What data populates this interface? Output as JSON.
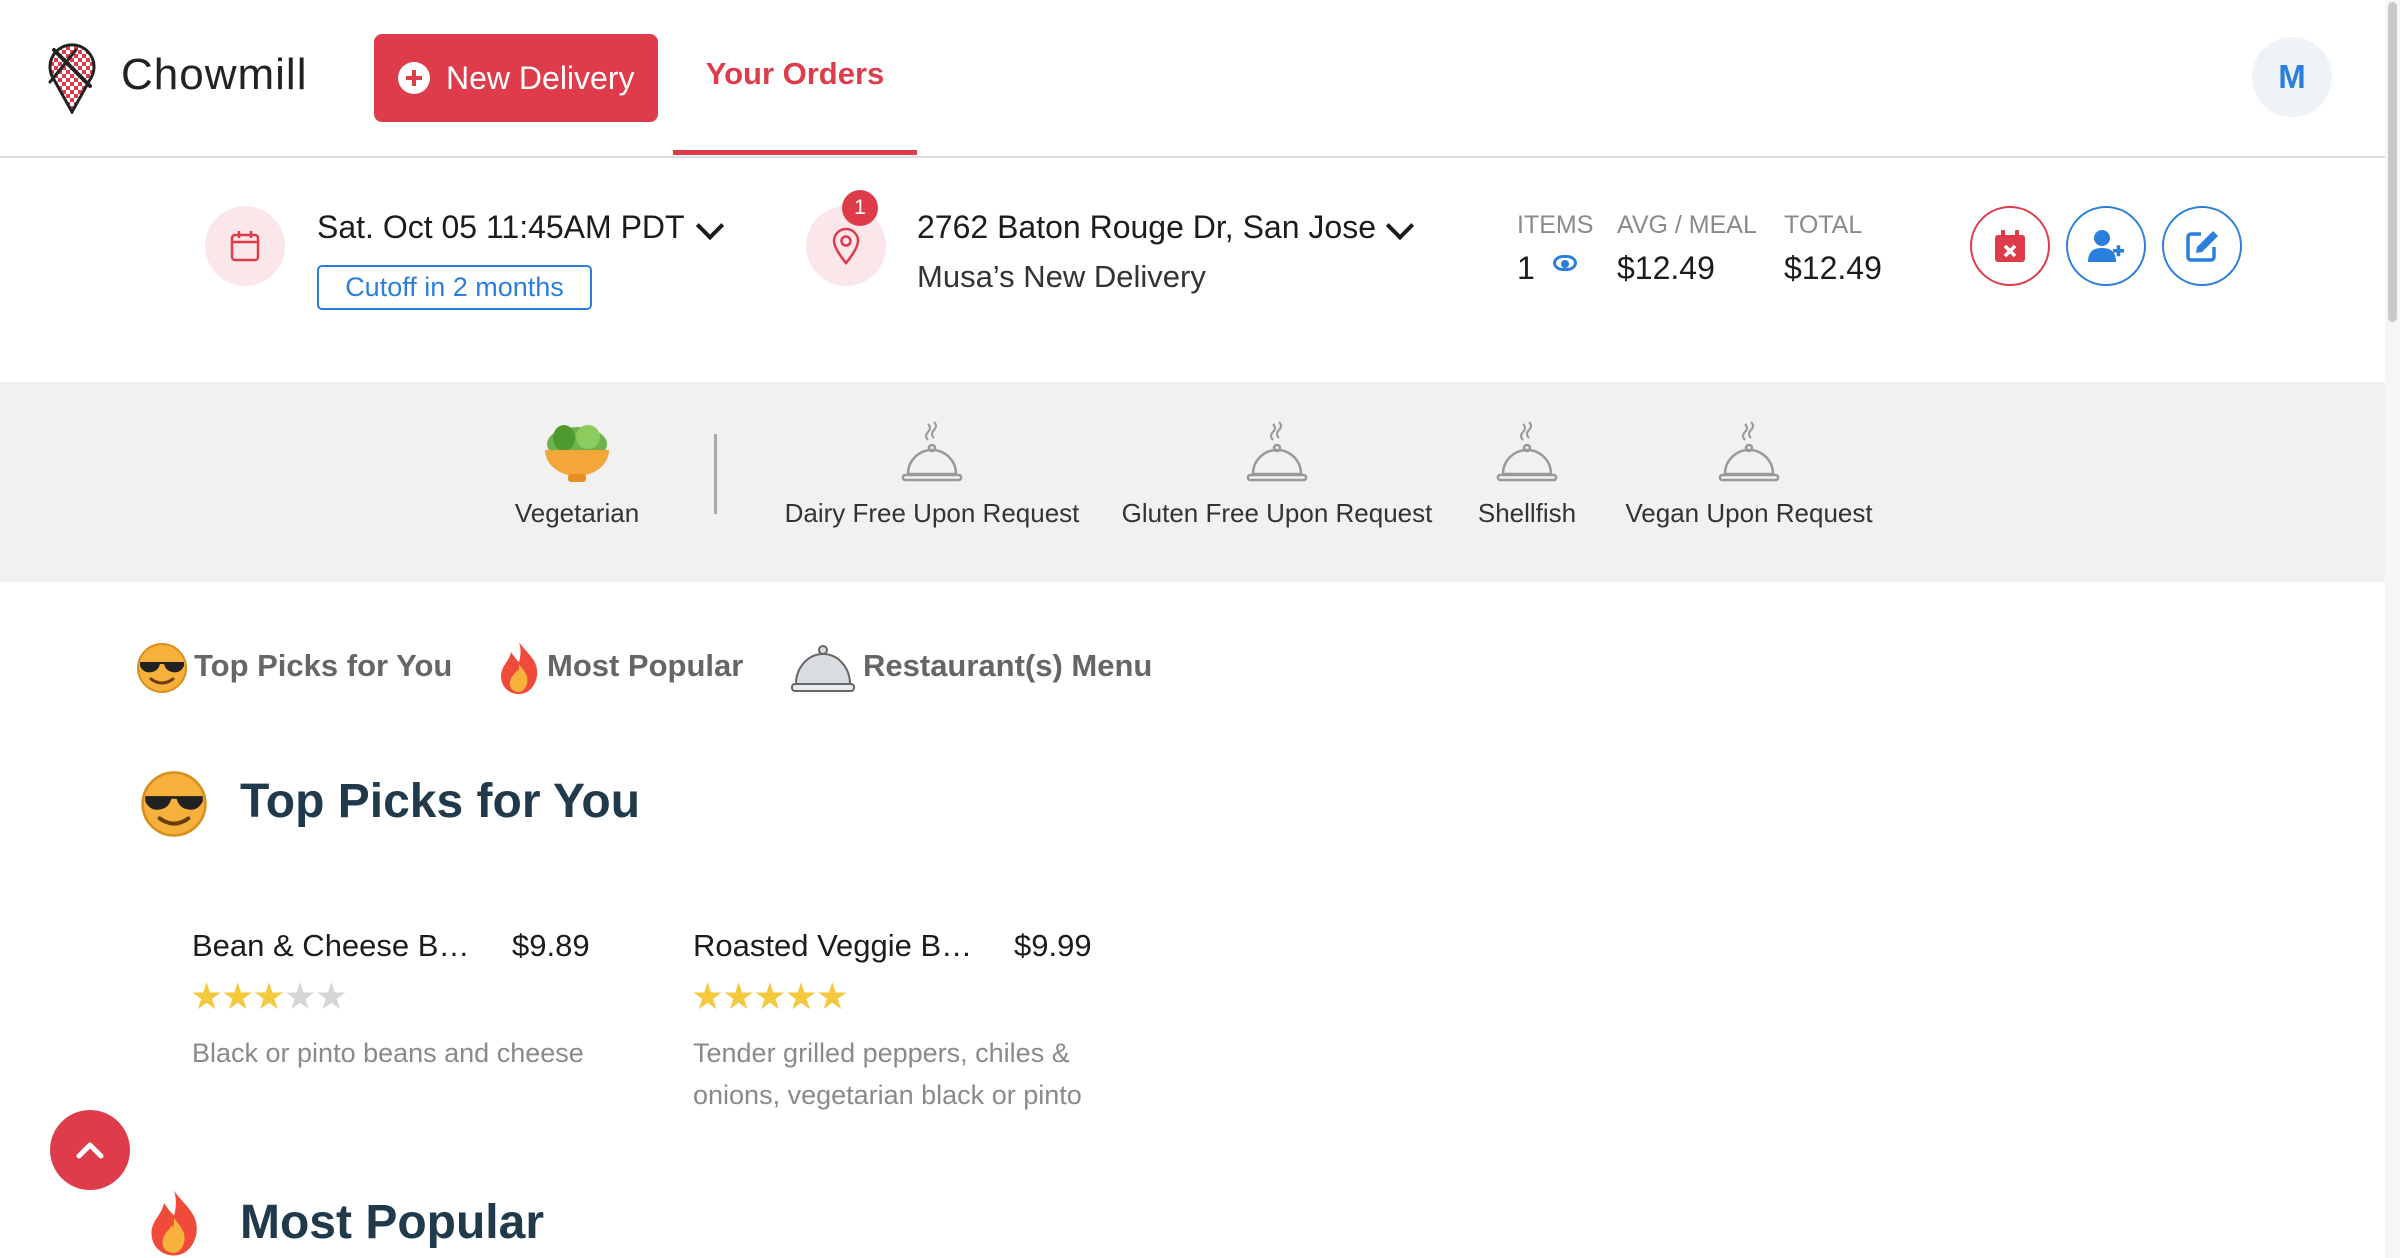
{
  "header": {
    "app_name": "Chowmill",
    "new_delivery_label": "New Delivery",
    "tab_your_orders": "Your Orders",
    "avatar_initial": "M",
    "brand_color": "#de3c4b",
    "accent_color": "#2b7fdc"
  },
  "order_bar": {
    "date_time": "Sat. Oct 05 11:45AM PDT",
    "cutoff": "Cutoff in 2 months",
    "location_badge": "1",
    "address": "2762 Baton Rouge Dr, San Jose",
    "delivery_name": "Musa’s New Delivery",
    "items_label": "ITEMS",
    "items_value": "1",
    "avg_label": "AVG / MEAL",
    "avg_value": "$12.49",
    "total_label": "TOTAL",
    "total_value": "$12.49",
    "actions": [
      {
        "icon": "calendar-x-icon",
        "color": "#de3c4b"
      },
      {
        "icon": "add-user-icon",
        "color": "#2b7fdc"
      },
      {
        "icon": "edit-icon",
        "color": "#2b7fdc"
      }
    ]
  },
  "dietary": [
    {
      "label": "Vegetarian",
      "icon": "salad-bowl-icon"
    },
    {
      "label": "Dairy Free Upon Request",
      "icon": "cloche-icon"
    },
    {
      "label": "Gluten Free Upon Request",
      "icon": "cloche-icon"
    },
    {
      "label": "Shellfish",
      "icon": "cloche-icon"
    },
    {
      "label": "Vegan Upon Request",
      "icon": "cloche-icon"
    }
  ],
  "section_nav": [
    {
      "label": "Top Picks for You",
      "icon": "sunglasses-face-icon"
    },
    {
      "label": "Most Popular",
      "icon": "fire-icon"
    },
    {
      "label": "Restaurant(s) Menu",
      "icon": "cloche-icon"
    }
  ],
  "sections": {
    "top_picks_title": "Top Picks for You",
    "most_popular_title": "Most Popular"
  },
  "items": [
    {
      "name": "Bean & Cheese B…",
      "price": "$9.89",
      "rating": 3,
      "rating_max": 5,
      "description": "Black or pinto beans and cheese"
    },
    {
      "name": "Roasted Veggie B…",
      "price": "$9.99",
      "rating": 5,
      "rating_max": 5,
      "description": "Tender grilled peppers, chiles & onions, vegetarian black or pinto"
    }
  ]
}
